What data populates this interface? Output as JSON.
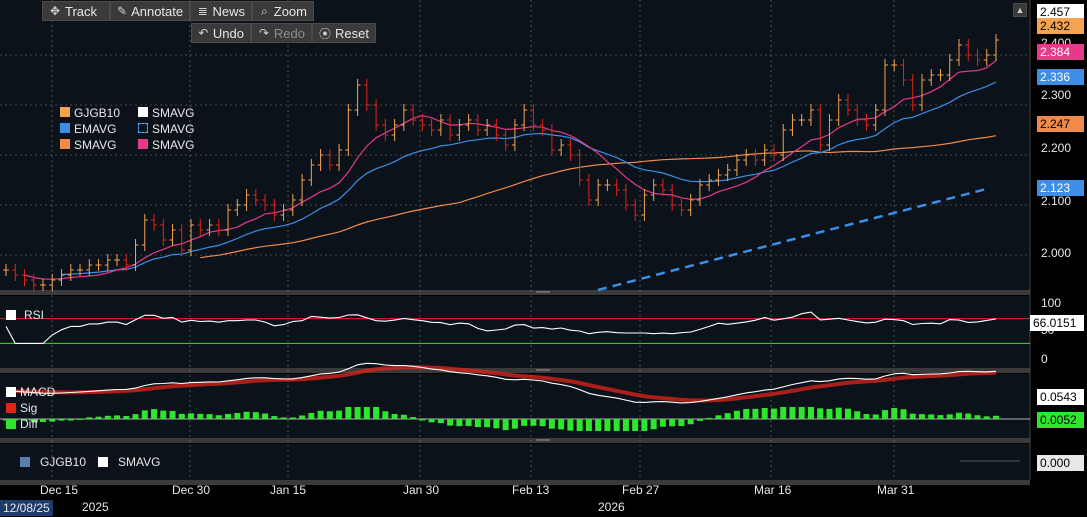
{
  "toolbar": {
    "track": "Track",
    "annotate": "Annotate",
    "news": "News",
    "zoom": "Zoom",
    "undo": "Undo",
    "redo": "Redo",
    "reset": "Reset"
  },
  "legend": {
    "items": [
      {
        "label": "GJGB10",
        "color": "#f4a451"
      },
      {
        "label": "SMAVG",
        "color": "#ffffff"
      },
      {
        "label": "EMAVG",
        "color": "#3d8ee6"
      },
      {
        "label": "SMAVG",
        "color": "#5aa8ff",
        "style": "dashed"
      },
      {
        "label": "SMAVG",
        "color": "#f08a4b"
      },
      {
        "label": "SMAVG",
        "color": "#e6398a"
      }
    ]
  },
  "price_axis": {
    "ticks": [
      "2.000",
      "2.100",
      "2.200",
      "2.300",
      "2.400"
    ],
    "tick_values": [
      2.0,
      2.1,
      2.2,
      2.3,
      2.4
    ],
    "range": [
      1.93,
      2.47
    ],
    "badges": [
      {
        "text": "2.457",
        "value": 2.457,
        "bg": "#ffffff",
        "fg": "#000000"
      },
      {
        "text": "2.432",
        "value": 2.432,
        "bg": "#f4a451",
        "fg": "#000000"
      },
      {
        "text": "2.384",
        "value": 2.384,
        "bg": "#e6398a",
        "fg": "#ffffff"
      },
      {
        "text": "2.336",
        "value": 2.336,
        "bg": "#3d8ee6",
        "fg": "#ffffff"
      },
      {
        "text": "2.247",
        "value": 2.247,
        "bg": "#f08a4b",
        "fg": "#000000"
      },
      {
        "text": "2.123",
        "value": 2.123,
        "bg": "#3d8ee6",
        "fg": "#ffffff"
      }
    ]
  },
  "rsi_panel": {
    "label": "RSI",
    "ticks": [
      "100",
      "50",
      "0"
    ],
    "badge": "66.0151",
    "upper_line": 70,
    "lower_line": 30
  },
  "macd_panel": {
    "labels": [
      {
        "label": "MACD",
        "color": "#ffffff"
      },
      {
        "label": "Sig",
        "color": "#e0241b"
      },
      {
        "label": "Diff",
        "color": "#2ee62e"
      }
    ],
    "badges": [
      {
        "text": "0.0543",
        "bg": "#ffffff",
        "fg": "#000000"
      },
      {
        "text": "0.0052",
        "bg": "#2ee62e",
        "fg": "#000000"
      }
    ]
  },
  "volume_panel": {
    "labels": [
      {
        "label": "GJGB10",
        "color": "#5b7fa8"
      },
      {
        "label": "SMAVG",
        "color": "#ffffff"
      }
    ],
    "badge": "0.000"
  },
  "x_axis": {
    "ticks": [
      "Dec 15",
      "Dec 30",
      "Jan 15",
      "Jan 30",
      "Feb 13",
      "Feb 27",
      "Mar 16",
      "Mar 31"
    ],
    "years": [
      "2025",
      "2026"
    ],
    "date_box": "12/08/25"
  },
  "chart_data": {
    "type": "line",
    "title": "",
    "series_names": [
      "GJGB10",
      "SMAVG",
      "EMAVG",
      "SMAVG",
      "SMAVG"
    ],
    "ohlc_close": [
      1.97,
      1.96,
      1.95,
      1.94,
      1.94,
      1.95,
      1.96,
      1.97,
      1.97,
      1.98,
      1.98,
      1.99,
      1.99,
      1.98,
      2.02,
      2.07,
      2.06,
      2.03,
      2.05,
      2.01,
      2.06,
      2.05,
      2.06,
      2.05,
      2.09,
      2.1,
      2.12,
      2.11,
      2.1,
      2.08,
      2.09,
      2.11,
      2.15,
      2.18,
      2.2,
      2.18,
      2.21,
      2.29,
      2.34,
      2.3,
      2.26,
      2.24,
      2.26,
      2.29,
      2.27,
      2.26,
      2.25,
      2.27,
      2.24,
      2.26,
      2.27,
      2.25,
      2.26,
      2.24,
      2.22,
      2.26,
      2.29,
      2.26,
      2.25,
      2.21,
      2.22,
      2.2,
      2.15,
      2.11,
      2.14,
      2.14,
      2.13,
      2.1,
      2.08,
      2.12,
      2.14,
      2.13,
      2.1,
      2.09,
      2.11,
      2.14,
      2.15,
      2.16,
      2.17,
      2.19,
      2.2,
      2.19,
      2.21,
      2.2,
      2.25,
      2.27,
      2.27,
      2.29,
      2.22,
      2.27,
      2.31,
      2.29,
      2.27,
      2.26,
      2.29,
      2.38,
      2.38,
      2.35,
      2.3,
      2.35,
      2.36,
      2.36,
      2.39,
      2.42,
      2.4,
      2.39,
      2.4,
      2.43
    ]
  }
}
